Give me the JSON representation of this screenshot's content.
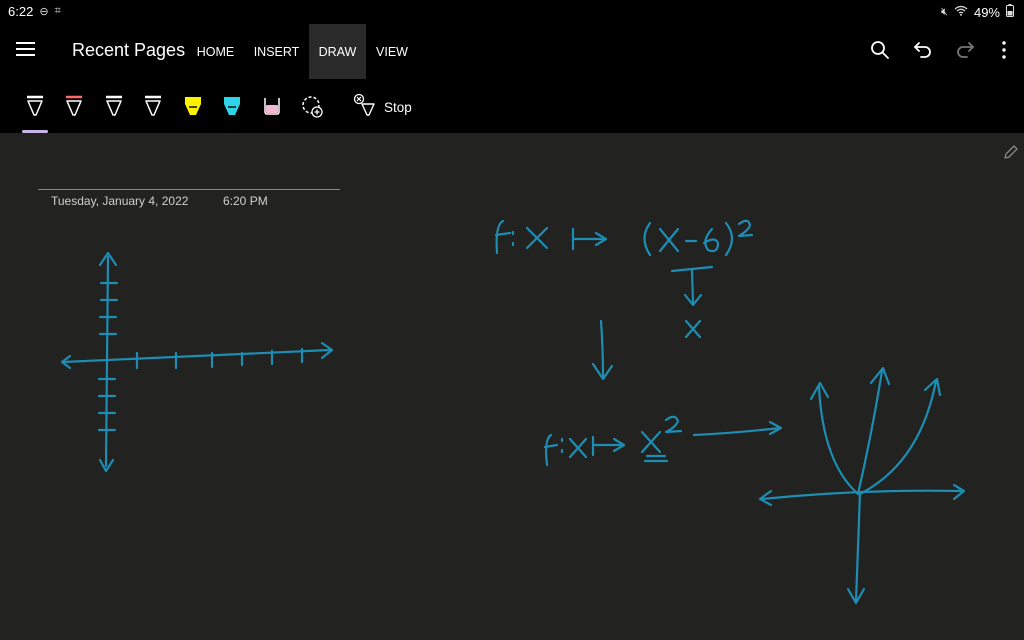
{
  "status": {
    "time": "6:22",
    "battery": "49%"
  },
  "topbar": {
    "title": "Recent Pages",
    "tabs": [
      {
        "label": "HOME"
      },
      {
        "label": "INSERT"
      },
      {
        "label": "DRAW"
      },
      {
        "label": "VIEW"
      }
    ],
    "active_tab": "DRAW"
  },
  "ribbon": {
    "pens": [
      {
        "name": "pen-white",
        "color": "#ffffff"
      },
      {
        "name": "pen-red",
        "color": "#ff6b6b"
      },
      {
        "name": "pen-white-2",
        "color": "#ffffff"
      },
      {
        "name": "pen-white-3",
        "color": "#ffffff"
      },
      {
        "name": "highlighter-yellow",
        "color": "#fff200"
      },
      {
        "name": "highlighter-cyan",
        "color": "#2fd3e8"
      },
      {
        "name": "highlighter-pink",
        "color": "#f2b8d6"
      }
    ],
    "stop_label": "Stop"
  },
  "page": {
    "date": "Tuesday, January 4, 2022",
    "time": "6:20 PM"
  },
  "ink_color": "#1d8db3"
}
